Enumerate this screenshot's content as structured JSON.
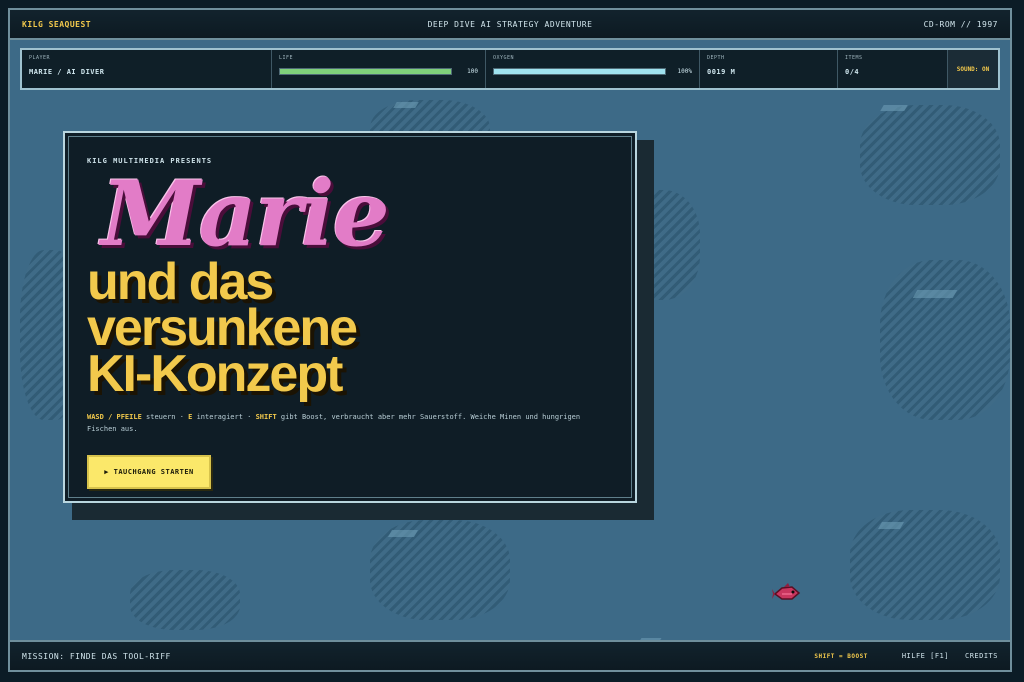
{
  "topbar": {
    "brand": "KILG SEAQUEST",
    "subtitle": "DEEP DIVE AI STRATEGY ADVENTURE",
    "edition": "CD-ROM // 1997"
  },
  "hud": {
    "player": {
      "label": "PLAYER",
      "value": "MARIE / AI DIVER"
    },
    "life": {
      "label": "LIFE",
      "value": "100",
      "level": 1.0,
      "color": "#7fd07a"
    },
    "oxygen": {
      "label": "OXYGEN",
      "value": "100%",
      "level": 1.0,
      "color": "#9fe2ef"
    },
    "depth": {
      "label": "DEPTH",
      "value": "0019 M"
    },
    "items": {
      "label": "ITEMS",
      "value": "0/4"
    },
    "sound": "SOUND: ON"
  },
  "title_card": {
    "presents": "KILG MULTIMEDIA PRESENTS",
    "title_script": "Marie",
    "headline": [
      "und das",
      "versunkene",
      "KI-Konzept"
    ],
    "help": {
      "key1": "WASD / PFEILE",
      "text1": " steuern · ",
      "key2": "E",
      "text2": " interagiert · ",
      "key3": "SHIFT",
      "text3": " gibt Boost, verbraucht aber mehr Sauerstoff. Weiche Minen und hungrigen Fischen aus."
    },
    "start_button": "▶ TAUCHGANG STARTEN"
  },
  "bottombar": {
    "mission": "MISSION: FINDE DAS TOOL-RIFF",
    "shift_hint": "SHIFT = BOOST",
    "help_link": "HILFE [F1]",
    "credits_link": "CREDITS"
  },
  "colors": {
    "accent": "#f2c94c",
    "title_pink": "#e27cc7",
    "ocean": "#3d6a87"
  }
}
